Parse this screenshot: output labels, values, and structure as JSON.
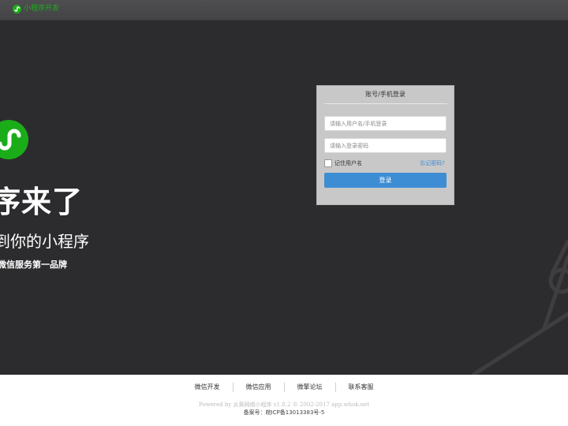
{
  "topbar": {
    "brand_label": "小程序开发"
  },
  "hero": {
    "title": "序来了",
    "subtitle": "到你的小程序",
    "tagline": "微信服务第一品牌"
  },
  "login": {
    "title": "账号/手机登录",
    "username_placeholder": "请输入用户名/手机登录",
    "password_placeholder": "请输入登录密码",
    "remember_label": "记住用户名",
    "remember_checked": false,
    "forgot_label": "忘记密码?",
    "submit_label": "登录"
  },
  "footer": {
    "links": [
      {
        "label": "微信开发"
      },
      {
        "label": "微信应用"
      },
      {
        "label": "微擎论坛"
      },
      {
        "label": "联系客服"
      }
    ],
    "powered": "Powered by 炎黄网络小程序 v1.8.2 © 2002-2017 app.whok.net",
    "icp": "备案号：皖ICP备13013383号-5"
  },
  "colors": {
    "brand_green": "#1aad19",
    "hero_bg": "#2c2c2e",
    "button_blue": "#3c8dd4",
    "link_blue": "#3b8ad6"
  }
}
